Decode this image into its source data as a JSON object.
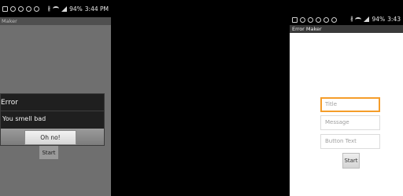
{
  "left_screen": {
    "status": {
      "battery": "94%",
      "time": "3:44 PM"
    },
    "app_title": "Maker",
    "dialog": {
      "title": "Error",
      "message": "You smell bad",
      "button": "Oh no!"
    },
    "start_button": "Start"
  },
  "right_screen": {
    "status": {
      "battery": "94%",
      "time": "3:43"
    },
    "app_title": "Error Maker",
    "fields": [
      {
        "placeholder": "Title",
        "focused": true
      },
      {
        "placeholder": "Message",
        "focused": false
      },
      {
        "placeholder": "Button Text",
        "focused": false
      }
    ],
    "start_button": "Start"
  },
  "colors": {
    "focus": "#f59d2a",
    "dialog_bg": "#1f1f1f",
    "action_bar": "#3a3a3a"
  }
}
